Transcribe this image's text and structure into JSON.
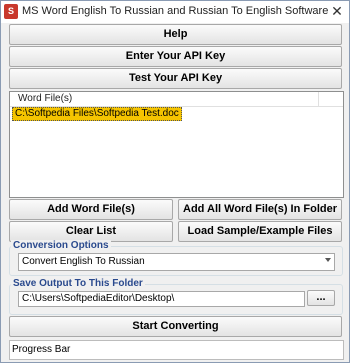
{
  "window": {
    "title": "MS Word English To Russian and Russian To English Software",
    "app_icon_glyph": "S",
    "close_glyph": "✕"
  },
  "buttons": {
    "help": "Help",
    "enter_api_key": "Enter Your API Key",
    "test_api_key": "Test Your API Key",
    "add_word_files": "Add Word File(s)",
    "add_all_in_folder": "Add All Word File(s) In Folder",
    "clear_list": "Clear List",
    "load_sample": "Load Sample/Example Files",
    "browse": "...",
    "start_converting": "Start Converting"
  },
  "file_list": {
    "column_header": "Word File(s)",
    "items": [
      "C:\\Softpedia Files\\Softpedia Test.doc"
    ]
  },
  "conversion_options": {
    "label": "Conversion Options",
    "selected": "Convert English To Russian"
  },
  "output": {
    "label": "Save Output To This Folder",
    "folder": "C:\\Users\\SoftpediaEditor\\Desktop\\"
  },
  "progress": {
    "label": "Progress Bar",
    "fraction": 0
  }
}
